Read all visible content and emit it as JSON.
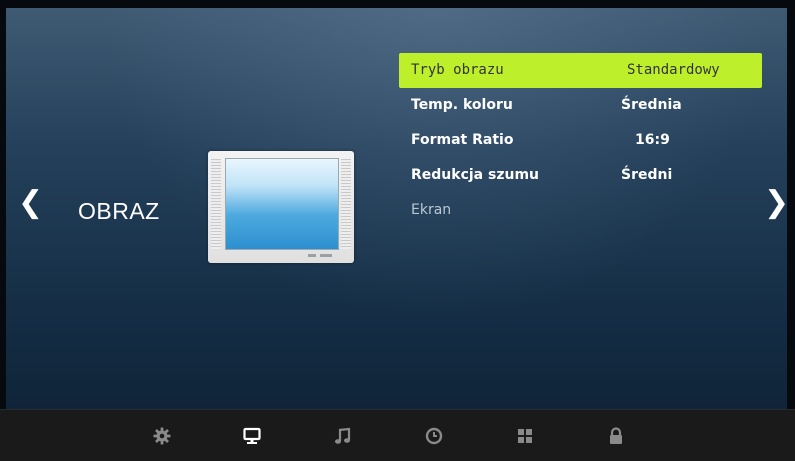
{
  "nav": {
    "prev_arrow": "❮",
    "next_arrow": "❯"
  },
  "section": {
    "title": "OBRAZ",
    "illustration_icon": "tv-icon"
  },
  "menu": {
    "items": [
      {
        "label": "Tryb obrazu",
        "value": "Standardowy",
        "selected": true
      },
      {
        "label": "Temp. koloru",
        "value": "Średnia"
      },
      {
        "label": "Format Ratio",
        "value": "16:9"
      },
      {
        "label": "Redukcja szumu",
        "value": "Średni"
      },
      {
        "label": "Ekran",
        "value": ""
      }
    ],
    "highlight_color": "#bdf02b"
  },
  "bottom_bar": {
    "icons": [
      {
        "name": "settings-gear-icon",
        "active": false
      },
      {
        "name": "picture-monitor-icon",
        "active": true
      },
      {
        "name": "sound-music-note-icon",
        "active": false
      },
      {
        "name": "time-clock-icon",
        "active": false
      },
      {
        "name": "options-grid-icon",
        "active": false
      },
      {
        "name": "lock-icon",
        "active": false
      }
    ]
  }
}
